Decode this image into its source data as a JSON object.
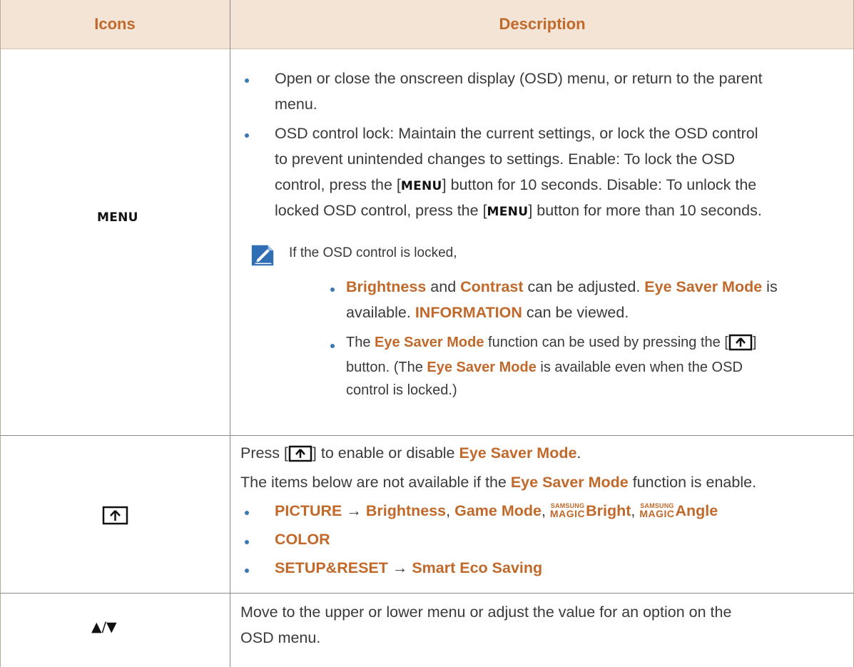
{
  "header": {
    "col_icons": "Icons",
    "col_description": "Description"
  },
  "rows": {
    "menu": {
      "icon_label": "MENU",
      "bullet1_line1": "Open or close the onscreen display (OSD) menu, or return to the parent",
      "bullet1_line2": "menu.",
      "bullet2_line1": "OSD control lock: Maintain the current settings, or lock the OSD control",
      "bullet2_line2": "to prevent unintended changes to settings. Enable: To lock the OSD",
      "bullet2_line3_pre": "control, press the [",
      "bullet2_line3_key": "MENU",
      "bullet2_line3_post": "] button for 10 seconds. Disable: To unlock the",
      "bullet2_line4_pre": "locked OSD control, press the [",
      "bullet2_line4_key": "MENU",
      "bullet2_line4_post": "] button for more than 10 seconds.",
      "note_icon": "note-pencil-icon",
      "note_intro": "If the OSD control is locked,",
      "note_b1_l1_a": "Brightness",
      "note_b1_l1_b": " and ",
      "note_b1_l1_c": "Contrast",
      "note_b1_l1_d": " can be adjusted. ",
      "note_b1_l1_e": "Eye Saver Mode",
      "note_b1_l1_f": " is",
      "note_b1_l2_a": "available. ",
      "note_b1_l2_b": "INFORMATION",
      "note_b1_l2_c": " can be viewed.",
      "note_b2_l1_a": "The ",
      "note_b2_l1_b": "Eye Saver Mode",
      "note_b2_l1_c": " function can be used by pressing the [",
      "note_b2_l1_d": "]",
      "note_b2_l2_a": "button. (The ",
      "note_b2_l2_b": "Eye Saver Mode",
      "note_b2_l2_c": " is available even when the OSD",
      "note_b2_l3": "control is locked.)"
    },
    "eye": {
      "icon": "eye-saver-button-icon",
      "line1_a": "Press [",
      "line1_b": "] to enable or disable ",
      "line1_c": "Eye Saver Mode",
      "line1_d": ".",
      "line2_a": "The items below are not available if the ",
      "line2_b": "Eye Saver Mode",
      "line2_c": " function is enable.",
      "item1_a": "PICTURE",
      "item1_arrow": " → ",
      "item1_b": "Brightness",
      "item1_sep1": ", ",
      "item1_c": "Game Mode",
      "item1_sep2": ", ",
      "magic_top": "SAMSUNG",
      "magic_bottom": "MAGIC",
      "item1_d": "Bright",
      "item1_sep3": ", ",
      "item1_e": "Angle",
      "item2": "COLOR",
      "item3_a": "SETUP&RESET",
      "item3_arrow": " → ",
      "item3_b": "Smart Eco Saving"
    },
    "updown": {
      "icon_label": "▲/▼",
      "line1": "Move to the upper or lower menu or adjust the value for an option on the",
      "line2": "OSD menu."
    }
  },
  "colors": {
    "accent": "#c1692a",
    "header_bg": "#f3e4d6",
    "bullet": "#3b78b8",
    "note_icon": "#2f6db5"
  }
}
